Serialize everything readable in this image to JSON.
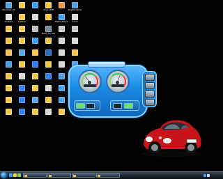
{
  "desktop": {
    "icons": [
      {
        "label": "Windows Ult",
        "color": "#5aa7e8"
      },
      {
        "label": "",
        "color": "#f2c94c"
      },
      {
        "label": "",
        "color": "#3aa0ee"
      },
      {
        "label": "Virus stuff",
        "color": "#f2c94c"
      },
      {
        "label": "",
        "color": "#f2994a"
      },
      {
        "label": "Digital Camera",
        "color": "#4f9ee0"
      },
      {
        "label": "YouTube",
        "color": "#e0e0e0"
      },
      {
        "label": "Cleaner",
        "color": "#f2c94c"
      },
      {
        "label": "",
        "color": "#d9d9d9"
      },
      {
        "label": "",
        "color": "#f2c94c"
      },
      {
        "label": "Media Player",
        "color": "#4f9ee0"
      },
      {
        "label": "Drive",
        "color": "#d9d9d9"
      },
      {
        "label": "",
        "color": "#f2c94c"
      },
      {
        "label": "",
        "color": "#f2c94c"
      },
      {
        "label": "",
        "color": "#bdbdbd"
      },
      {
        "label": "Need for Speed",
        "color": "#7a8a9a"
      },
      {
        "label": "",
        "color": "#c9c9c9"
      },
      {
        "label": "",
        "color": "#c9c9c9"
      },
      {
        "label": "",
        "color": "#f2c94c"
      },
      {
        "label": "",
        "color": "#f2c94c"
      },
      {
        "label": "",
        "color": "#3aa0ee"
      },
      {
        "label": "",
        "color": "#f2c94c"
      },
      {
        "label": "",
        "color": "#d9d9d9"
      },
      {
        "label": "",
        "color": "#d9d9d9"
      },
      {
        "label": "",
        "color": "#f2c94c"
      },
      {
        "label": "",
        "color": "#5aa7e8"
      },
      {
        "label": "",
        "color": "#f2c94c"
      },
      {
        "label": "",
        "color": "#2b6ec0"
      },
      {
        "label": "",
        "color": "#d9d9d9"
      },
      {
        "label": "",
        "color": "#f2c94c"
      },
      {
        "label": "",
        "color": "#4f9ee0"
      },
      {
        "label": "",
        "color": "#f2c94c"
      },
      {
        "label": "",
        "color": "#2f80ed"
      },
      {
        "label": "",
        "color": "#f2c94c"
      },
      {
        "label": "",
        "color": "#d9d9d9"
      },
      {
        "label": "",
        "color": "#5aa7e8"
      },
      {
        "label": "",
        "color": "#f2c94c"
      },
      {
        "label": "",
        "color": "#d9d9d9"
      },
      {
        "label": "",
        "color": "#f2c94c"
      },
      {
        "label": "",
        "color": "#2f80ed"
      },
      {
        "label": "",
        "color": "#4f9ee0"
      },
      {
        "label": "",
        "color": "#d9d9d9"
      },
      {
        "label": "",
        "color": "#f2c94c"
      },
      {
        "label": "",
        "color": "#2f80ed"
      },
      {
        "label": "",
        "color": "#f2c94c"
      },
      {
        "label": "",
        "color": "#d9d9d9"
      },
      {
        "label": "",
        "color": "#4f9ee0"
      },
      {
        "label": "",
        "color": "#f2c94c"
      },
      {
        "label": "",
        "color": "#f2c94c"
      },
      {
        "label": "",
        "color": "#2f80ed"
      },
      {
        "label": "",
        "color": "#5aa7e8"
      },
      {
        "label": "",
        "color": "#f2c94c"
      },
      {
        "label": "",
        "color": "#4f9ee0"
      },
      {
        "label": "",
        "color": "#d9d9d9"
      },
      {
        "label": "",
        "color": "#f2c94c"
      },
      {
        "label": "",
        "color": "#2f80ed"
      },
      {
        "label": "",
        "color": "#f2c94c"
      },
      {
        "label": "",
        "color": "#d9d9d9"
      },
      {
        "label": "",
        "color": "#f2c94c"
      },
      {
        "label": "",
        "color": "#2f80ed"
      }
    ]
  },
  "gadget": {
    "title": "",
    "left_gauge_readout": "",
    "right_gauge_readout": "",
    "body_color": "#1b8fe6"
  },
  "car": {
    "plate": "",
    "color": "#d21a1a"
  },
  "taskbar": {
    "tasks": [
      {
        "label": ""
      },
      {
        "label": ""
      },
      {
        "label": ""
      },
      {
        "label": ""
      }
    ],
    "clock": ""
  }
}
